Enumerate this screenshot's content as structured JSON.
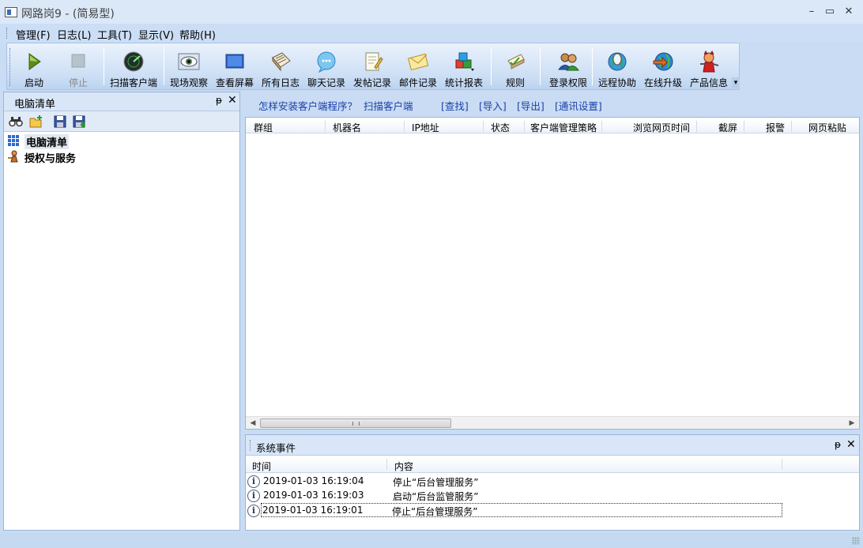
{
  "window": {
    "title": "网路岗9 - (简易型)",
    "minimize": "–",
    "maximize": "▭",
    "close": "✕"
  },
  "menu": [
    "管理(F)",
    "日志(L)",
    "工具(T)",
    "显示(V)",
    "帮助(H)"
  ],
  "toolbar": {
    "start": "启动",
    "stop": "停止",
    "scan": "扫描客户端",
    "live_view": "现场观察",
    "view_screen": "查看屏幕",
    "all_logs": "所有日志",
    "chat_logs": "聊天记录",
    "post_logs": "发帖记录",
    "mail_logs": "邮件记录",
    "stats": "统计报表",
    "rules": "规则",
    "login_perm": "登录权限",
    "remote_help": "远程协助",
    "online_upgrade": "在线升级",
    "product_info": "产品信息",
    "overflow": "▾"
  },
  "left_panel": {
    "title": "电脑清单",
    "pin": "ᵽ",
    "close": "✕",
    "tree": [
      "电脑清单",
      "授权与服务"
    ]
  },
  "links": {
    "how_install": "怎样安装客户端程序？",
    "scan_client": "扫描客户端",
    "find": "[查找]",
    "import": "[导入]",
    "export": "[导出]",
    "comm_settings": "[通讯设置]"
  },
  "grid": {
    "columns": [
      "群组",
      "机器名",
      "IP地址",
      "状态",
      "客户端管理策略",
      "浏览网页时间",
      "截屏",
      "报警",
      "网页粘贴"
    ],
    "left_arrow": "◀",
    "right_arrow": "▶"
  },
  "events": {
    "title": "系统事件",
    "pin": "ᵽ",
    "close": "✕",
    "col_time": "时间",
    "col_content": "内容",
    "rows": [
      {
        "time": "2019-01-03 16:19:04",
        "content": "停止“后台管理服务”"
      },
      {
        "time": "2019-01-03 16:19:03",
        "content": "启动“后台监管服务”"
      },
      {
        "time": "2019-01-03 16:19:01",
        "content": "停止“后台管理服务”"
      }
    ],
    "info_icon": "i"
  },
  "colors": {
    "accent": "#1a3fa8",
    "panel_header": "#d8e6f7",
    "background": "#c9dcf3"
  }
}
